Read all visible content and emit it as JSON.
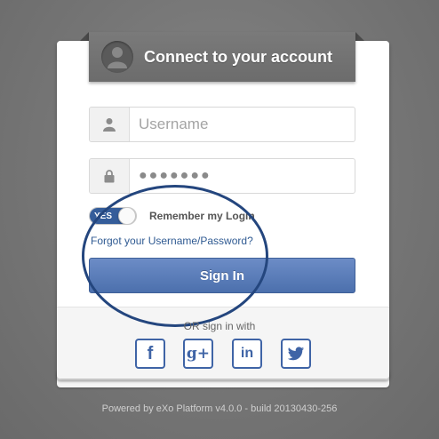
{
  "header": {
    "title": "Connect to your account",
    "avatar_icon": "user-avatar-icon"
  },
  "form": {
    "username": {
      "placeholder": "Username",
      "value": "",
      "icon": "user-icon"
    },
    "password": {
      "value": "●●●●●●●",
      "icon": "lock-icon"
    },
    "remember": {
      "toggle_label": "YES",
      "label": "Remember my Login",
      "checked": true
    },
    "forgot_link": "Forgot your Username/Password?",
    "signin_button": "Sign In"
  },
  "social": {
    "heading": "OR sign in with",
    "providers": [
      {
        "name": "facebook",
        "glyph": "f"
      },
      {
        "name": "google-plus",
        "glyph": "g+"
      },
      {
        "name": "linkedin",
        "glyph": "in"
      },
      {
        "name": "twitter",
        "glyph": "twitter-bird"
      }
    ]
  },
  "footer": {
    "powered_by": "Powered by eXo Platform v4.0.0 - build 20130430-256"
  },
  "colors": {
    "accent": "#4c70ad",
    "link": "#2f5a92",
    "social": "#3f64a6",
    "highlight": "#24467e"
  }
}
